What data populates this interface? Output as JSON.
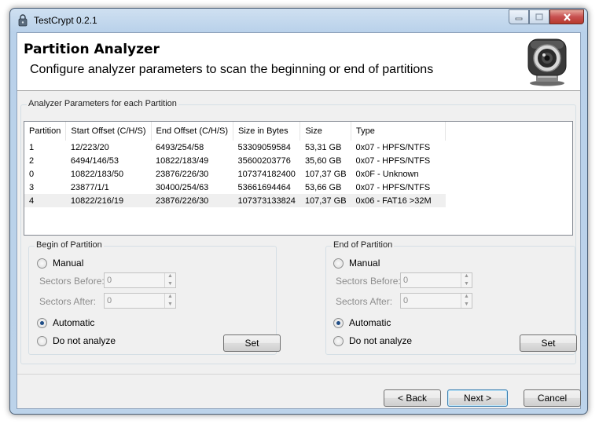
{
  "window": {
    "title": "TestCrypt 0.2.1",
    "app_icon": "lock-icon"
  },
  "caption": {
    "minimize_icon": "minimize-icon",
    "maximize_icon": "maximize-icon",
    "close_icon": "close-icon"
  },
  "header": {
    "title": "Partition Analyzer",
    "subtitle": "Configure analyzer parameters to scan the beginning or end of partitions",
    "logo": "webcam-icon"
  },
  "params_group": {
    "label": "Analyzer Parameters for each Partition"
  },
  "table": {
    "columns": [
      "Partition",
      "Start Offset (C/H/S)",
      "End Offset (C/H/S)",
      "Size in Bytes",
      "Size",
      "Type"
    ],
    "rows": [
      [
        "1",
        "12/223/20",
        "6493/254/58",
        "53309059584",
        "53,31 GB",
        "0x07 - HPFS/NTFS"
      ],
      [
        "2",
        "6494/146/53",
        "10822/183/49",
        "35600203776",
        "35,60 GB",
        "0x07 - HPFS/NTFS"
      ],
      [
        "0",
        "10822/183/50",
        "23876/226/30",
        "107374182400",
        "107,37 GB",
        "0x0F - Unknown"
      ],
      [
        "3",
        "23877/1/1",
        "30400/254/63",
        "53661694464",
        "53,66 GB",
        "0x07 - HPFS/NTFS"
      ],
      [
        "4",
        "10822/216/19",
        "23876/226/30",
        "107373133824",
        "107,37 GB",
        "0x06 - FAT16 >32M"
      ]
    ],
    "selected_row": 4
  },
  "begin": {
    "label": "Begin of Partition",
    "manual": "Manual",
    "sectors_before_label": "Sectors Before:",
    "sectors_before": "0",
    "sectors_after_label": "Sectors After:",
    "sectors_after": "0",
    "automatic": "Automatic",
    "do_not_analyze": "Do not analyze",
    "set": "Set",
    "selected": "Automatic"
  },
  "end": {
    "label": "End of Partition",
    "manual": "Manual",
    "sectors_before_label": "Sectors Before:",
    "sectors_before": "0",
    "sectors_after_label": "Sectors After:",
    "sectors_after": "0",
    "automatic": "Automatic",
    "do_not_analyze": "Do not analyze",
    "set": "Set",
    "selected": "Automatic"
  },
  "footer": {
    "back": "< Back",
    "next": "Next >",
    "cancel": "Cancel"
  }
}
